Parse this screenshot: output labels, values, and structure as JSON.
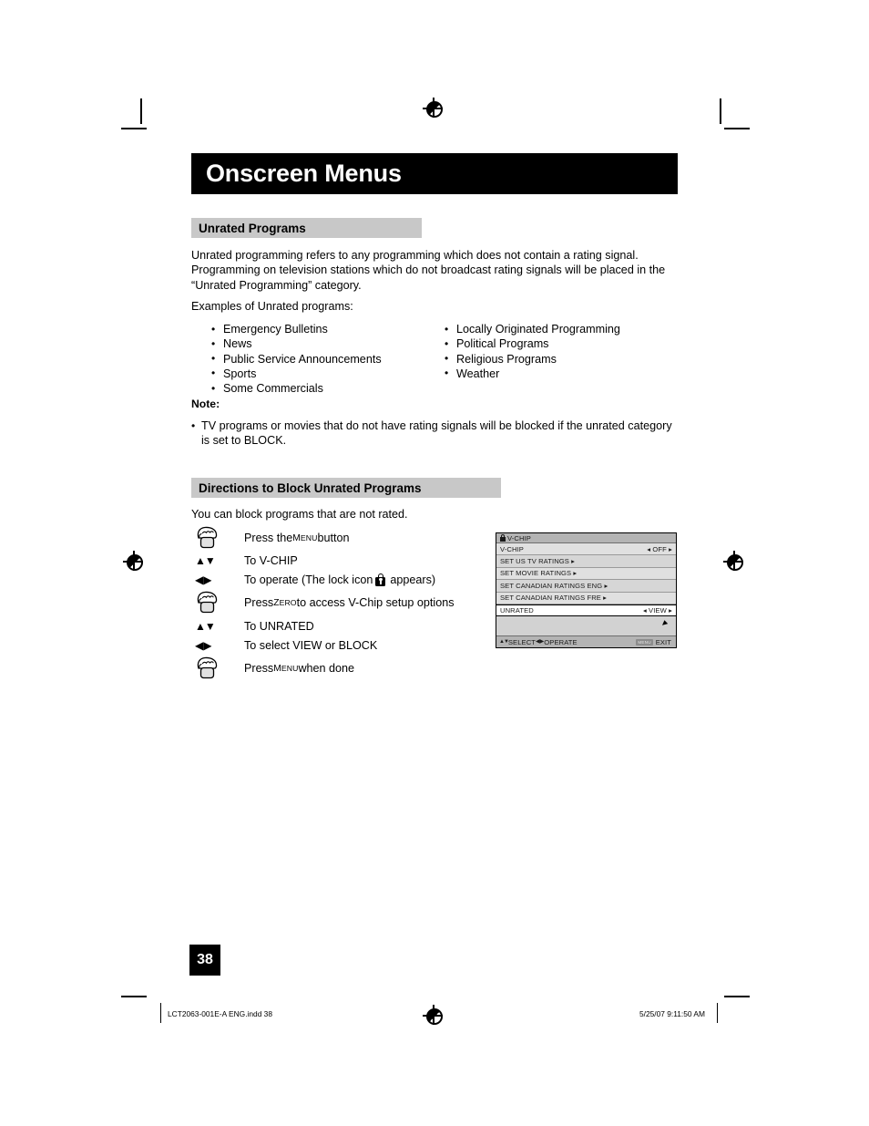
{
  "page": {
    "title": "Onscreen Menus",
    "number": "38"
  },
  "sections": {
    "unrated": {
      "heading": "Unrated Programs",
      "intro": "Unrated programming refers to any programming which does not contain a rating signal. Programming on television stations which do not broadcast rating signals will be placed in the “Unrated Programming” category.",
      "examples_label": "Examples of Unrated programs:",
      "examples_left": [
        "Emergency Bulletins",
        "News",
        "Public Service Announcements",
        "Sports",
        "Some Commercials"
      ],
      "examples_right": [
        "Locally Originated Programming",
        "Political Programs",
        "Religious Programs",
        "Weather"
      ],
      "note_label": "Note:",
      "notes": [
        "TV programs or movies that do not have rating signals will be blocked if the unrated category is set to BLOCK."
      ]
    },
    "directions": {
      "heading": "Directions to Block Unrated Programs",
      "intro": "You can block programs that are not rated.",
      "steps": [
        {
          "icon": "hand-press-icon",
          "text_before": "Press the ",
          "small_caps": "Menu",
          "text_after": " button"
        },
        {
          "icon": "up-down-arrows-icon",
          "text_before": "To V-CHIP",
          "small_caps": "",
          "text_after": ""
        },
        {
          "icon": "left-right-arrows-icon",
          "text_before": "To operate (The lock icon ",
          "small_caps": "",
          "text_after": " appears)",
          "has_lock": true
        },
        {
          "icon": "hand-press-icon",
          "text_before": "Press ",
          "small_caps": "Zero",
          "text_after": " to access V-Chip setup options"
        },
        {
          "icon": "up-down-arrows-icon",
          "text_before": "To UNRATED",
          "small_caps": "",
          "text_after": ""
        },
        {
          "icon": "left-right-arrows-icon",
          "text_before": "To select VIEW or BLOCK",
          "small_caps": "",
          "text_after": ""
        },
        {
          "icon": "hand-press-icon",
          "text_before": "Press ",
          "small_caps": "Menu",
          "text_after": " when done"
        }
      ]
    }
  },
  "tv_menu": {
    "title": "V-CHIP",
    "rows": [
      {
        "label": "V-CHIP",
        "value": "◂ OFF ▸",
        "selected": false
      },
      {
        "label": "SET US TV RATINGS ▸",
        "value": "",
        "selected": false
      },
      {
        "label": "SET MOVIE RATINGS ▸",
        "value": "",
        "selected": false
      },
      {
        "label": "SET CANADIAN RATINGS ENG ▸",
        "value": "",
        "selected": false
      },
      {
        "label": "SET CANADIAN RATINGS FRE ▸",
        "value": "",
        "selected": false
      },
      {
        "label": "UNRATED",
        "value": "◂ VIEW ▸",
        "selected": true
      }
    ],
    "footer": {
      "select": "SELECT",
      "operate": "OPERATE",
      "menu_key": "MENU",
      "exit": "EXIT"
    }
  },
  "footer": {
    "file_name": "LCT2063-001E-A ENG.indd   38",
    "timestamp": "5/25/07   9:11:50 AM"
  }
}
